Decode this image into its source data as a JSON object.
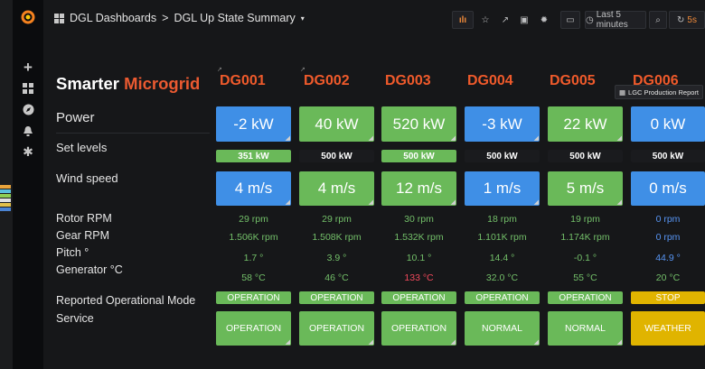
{
  "breadcrumb": {
    "root": "DGL Dashboards",
    "sep": ">",
    "current": "DGL Up State Summary",
    "caret": "▾"
  },
  "toolbar": {
    "time_range": "Last 5 minutes",
    "refresh": "5s"
  },
  "sublink": {
    "label": "LGC Production Report"
  },
  "title": {
    "part1": "Smarter ",
    "part2": "Microgrid"
  },
  "labels": {
    "power": "Power",
    "set_levels": "Set levels",
    "wind_speed": "Wind speed",
    "rotor": "Rotor RPM",
    "gear": "Gear RPM",
    "pitch": "Pitch °",
    "generator": "Generator °C",
    "mode": "Reported Operational Mode",
    "service": "Service"
  },
  "generators": [
    {
      "name": "DG001",
      "power": "-2 kW",
      "set": "351 kW",
      "wind": "4 m/s",
      "rotor": "29 rpm",
      "gear": "1.506K rpm",
      "pitch": "1.7 °",
      "gen": "58 °C",
      "mode": "OPERATION",
      "service": "OPERATION"
    },
    {
      "name": "DG002",
      "power": "40 kW",
      "set": "500 kW",
      "wind": "4 m/s",
      "rotor": "29 rpm",
      "gear": "1.508K rpm",
      "pitch": "3.9 °",
      "gen": "46 °C",
      "mode": "OPERATION",
      "service": "OPERATION"
    },
    {
      "name": "DG003",
      "power": "520 kW",
      "set": "500 kW",
      "wind": "12 m/s",
      "rotor": "30 rpm",
      "gear": "1.532K rpm",
      "pitch": "10.1 °",
      "gen": "133 °C",
      "mode": "OPERATION",
      "service": "OPERATION"
    },
    {
      "name": "DG004",
      "power": "-3 kW",
      "set": "500 kW",
      "wind": "1 m/s",
      "rotor": "18 rpm",
      "gear": "1.101K rpm",
      "pitch": "14.4 °",
      "gen": "32.0 °C",
      "mode": "OPERATION",
      "service": "NORMAL"
    },
    {
      "name": "DG005",
      "power": "22 kW",
      "set": "500 kW",
      "wind": "5 m/s",
      "rotor": "19 rpm",
      "gear": "1.174K rpm",
      "pitch": "-0.1 °",
      "gen": "55 °C",
      "mode": "OPERATION",
      "service": "NORMAL"
    },
    {
      "name": "DG006",
      "power": "0 kW",
      "set": "500 kW",
      "wind": "0 m/s",
      "rotor": "0 rpm",
      "gear": "0 rpm",
      "pitch": "44.9 °",
      "gen": "20 °C",
      "mode": "STOP",
      "service": "WEATHER"
    }
  ],
  "colors": {
    "accent": "#eb5a31",
    "green": "#6ab959",
    "blue": "#3f8fe6",
    "yellow": "#e0b400",
    "red": "#f2495c"
  }
}
